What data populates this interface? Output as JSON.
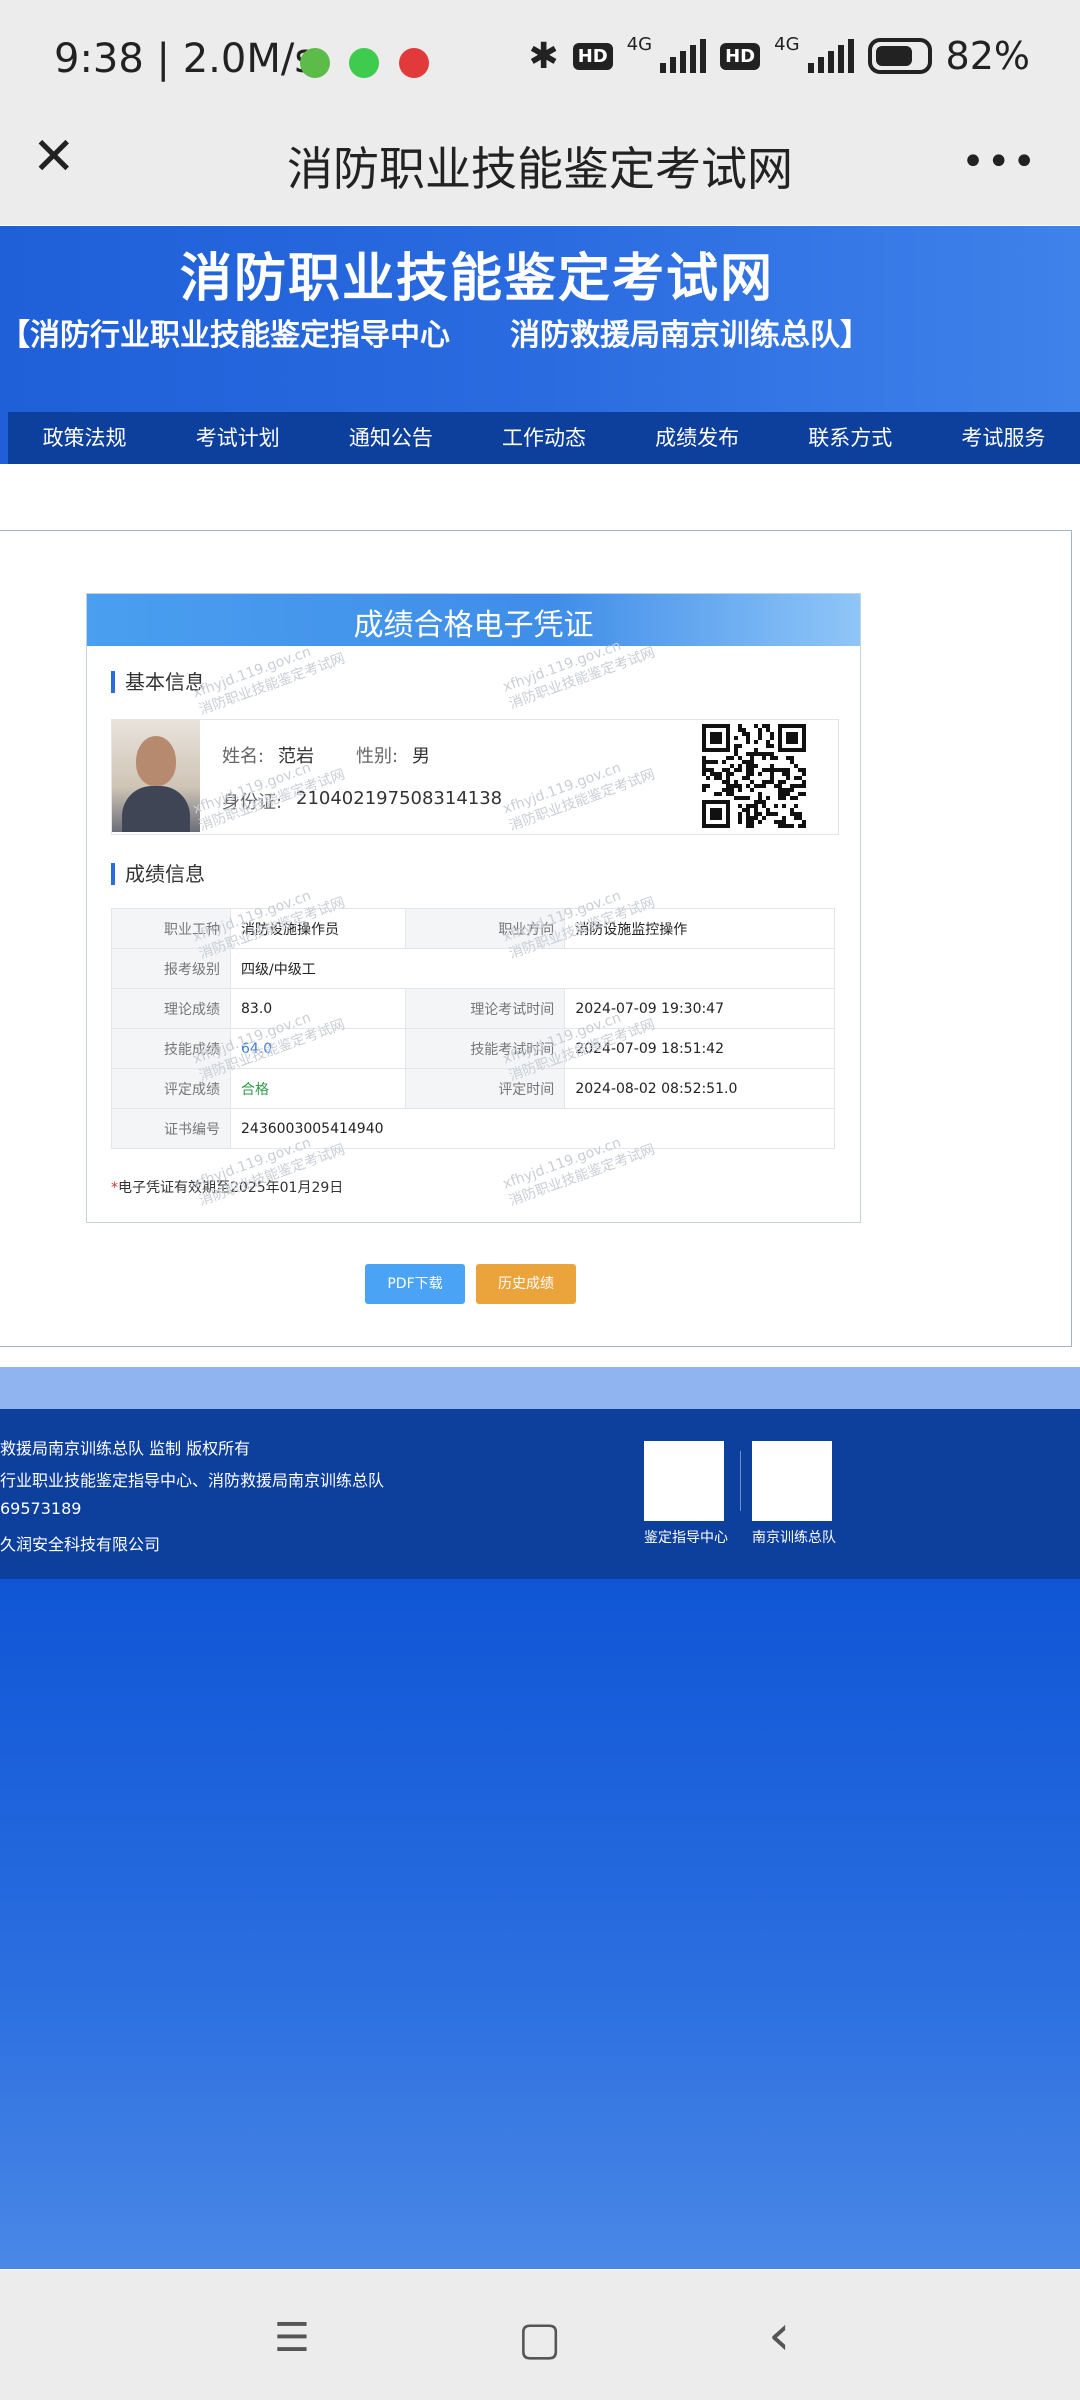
{
  "status_bar": {
    "time_speed": "9:38 | 2.0M/s",
    "network_1": "4G",
    "network_2": "4G",
    "hd_1": "HD",
    "hd_2": "HD",
    "battery": "82%"
  },
  "title_bar": {
    "close_icon": "✕",
    "title": "消防职业技能鉴定考试网",
    "more_icon": "•••"
  },
  "banner": {
    "title": "消防职业技能鉴定考试网",
    "subtitle": "【消防行业职业技能鉴定指导中心　　消防救援局南京训练总队】"
  },
  "nav": [
    "政策法规",
    "考试计划",
    "通知公告",
    "工作动态",
    "成绩发布",
    "联系方式",
    "考试服务"
  ],
  "certificate": {
    "header_title": "成绩合格电子凭证",
    "basic_title": "基本信息",
    "name_label": "姓名:",
    "name": "范岩",
    "gender_label": "性别:",
    "gender": "男",
    "id_label": "身份证:",
    "id_number": "210402197508314138",
    "score_title": "成绩信息",
    "rows": {
      "job_type_label": "职业工种",
      "job_type": "消防设施操作员",
      "job_direction_label": "职业方向",
      "job_direction": "消防设施监控操作",
      "level_label": "报考级别",
      "level": "四级/中级工",
      "theory_score_label": "理论成绩",
      "theory_score": "83.0",
      "theory_time_label": "理论考试时间",
      "theory_time": "2024-07-09 19:30:47",
      "skill_score_label": "技能成绩",
      "skill_score": "64.0",
      "skill_time_label": "技能考试时间",
      "skill_time": "2024-07-09 18:51:42",
      "eval_result_label": "评定成绩",
      "eval_result": "合格",
      "eval_time_label": "评定时间",
      "eval_time": "2024-08-02 08:52:51.0",
      "cert_no_label": "证书编号",
      "cert_no": "2436003005414940"
    },
    "note_star": "*",
    "note": "电子凭证有效期至2025年01月29日",
    "watermark_url": "xfhyjd.119.gov.cn",
    "watermark_text": "消防职业技能鉴定考试网"
  },
  "buttons": {
    "pdf": "PDF下载",
    "history": "历史成绩"
  },
  "footer": {
    "line1": "救援局南京训练总队 监制 版权所有",
    "line2": "行业职业技能鉴定指导中心、消防救援局南京训练总队",
    "line3": "69573189",
    "line4": "久润安全科技有限公司",
    "qr1_label": "鉴定指导中心",
    "qr2_label": "南京训练总队"
  },
  "system_nav": {
    "menu_icon": "☰",
    "home_icon": "▢",
    "back_icon": "‹"
  },
  "colors": {
    "banner_blue": "#2a6be0",
    "nav_blue": "#0d3f9c",
    "pdf_button": "#4aa3f5",
    "history_button": "#eba43c",
    "pass_green": "#2e9d4a"
  }
}
